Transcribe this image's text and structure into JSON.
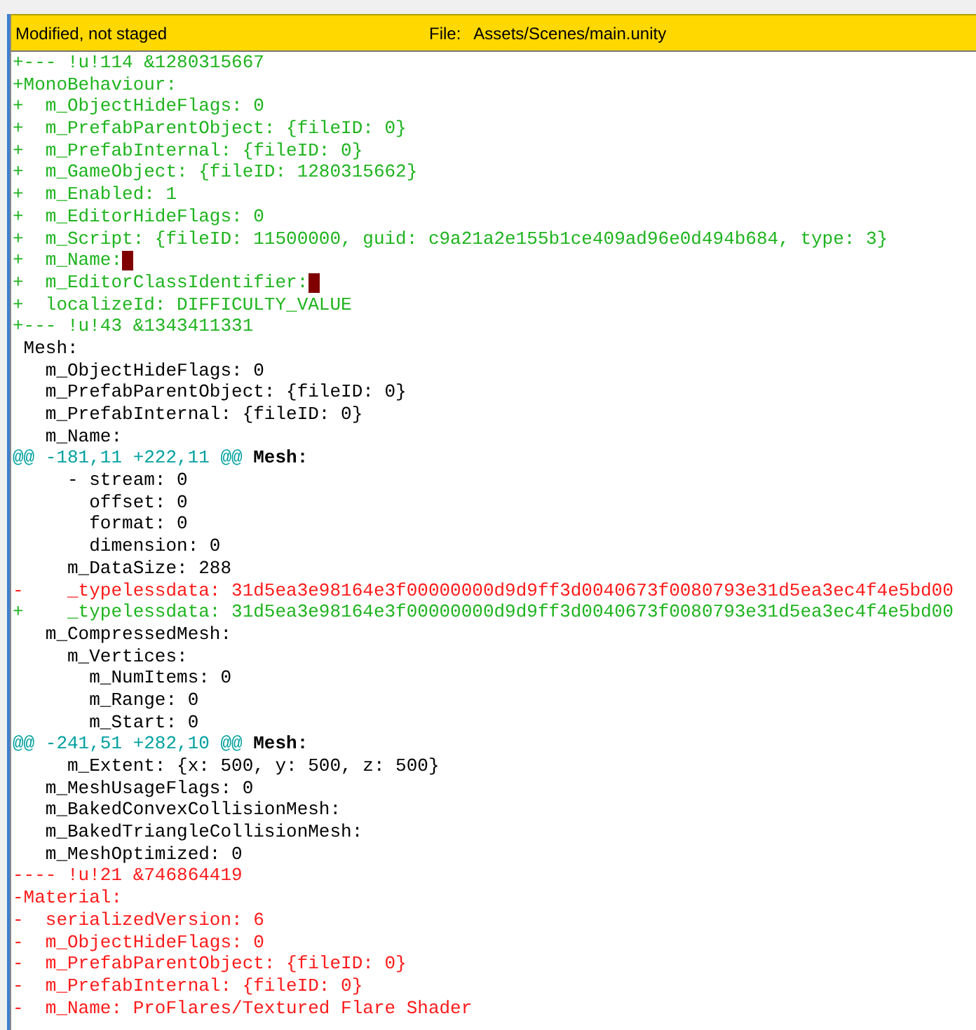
{
  "header": {
    "status": "Modified, not staged",
    "file_label": "File:",
    "file_path": "Assets/Scenes/main.unity"
  },
  "lines": [
    {
      "kind": "add",
      "text": "+--- !u!114 &1280315667"
    },
    {
      "kind": "add",
      "text": "+MonoBehaviour:"
    },
    {
      "kind": "add",
      "text": "+  m_ObjectHideFlags: 0"
    },
    {
      "kind": "add",
      "text": "+  m_PrefabParentObject: {fileID: 0}"
    },
    {
      "kind": "add",
      "text": "+  m_PrefabInternal: {fileID: 0}"
    },
    {
      "kind": "add",
      "text": "+  m_GameObject: {fileID: 1280315662}"
    },
    {
      "kind": "add",
      "text": "+  m_Enabled: 1"
    },
    {
      "kind": "add",
      "text": "+  m_EditorHideFlags: 0"
    },
    {
      "kind": "add",
      "text": "+  m_Script: {fileID: 11500000, guid: c9a21a2e155b1ce409ad96e0d494b684, type: 3}"
    },
    {
      "kind": "add",
      "text": "+  m_Name:",
      "trailing_whitespace": true
    },
    {
      "kind": "add",
      "text": "+  m_EditorClassIdentifier:",
      "trailing_whitespace": true
    },
    {
      "kind": "add",
      "text": "+  localizeId: DIFFICULTY_VALUE"
    },
    {
      "kind": "add",
      "text": "+--- !u!43 &1343411331"
    },
    {
      "kind": "context",
      "text": " Mesh:"
    },
    {
      "kind": "context",
      "text": "   m_ObjectHideFlags: 0"
    },
    {
      "kind": "context",
      "text": "   m_PrefabParentObject: {fileID: 0}"
    },
    {
      "kind": "context",
      "text": "   m_PrefabInternal: {fileID: 0}"
    },
    {
      "kind": "context",
      "text": "   m_Name:"
    },
    {
      "kind": "hunk",
      "text": "@@ -181,11 +222,11 @@",
      "section": "Mesh:"
    },
    {
      "kind": "context",
      "text": "     - stream: 0"
    },
    {
      "kind": "context",
      "text": "       offset: 0"
    },
    {
      "kind": "context",
      "text": "       format: 0"
    },
    {
      "kind": "context",
      "text": "       dimension: 0"
    },
    {
      "kind": "context",
      "text": "     m_DataSize: 288"
    },
    {
      "kind": "del",
      "text": "-    _typelessdata: 31d5ea3e98164e3f00000000d9d9ff3d0040673f0080793e31d5ea3ec4f4e5bd00"
    },
    {
      "kind": "add",
      "text": "+    _typelessdata: 31d5ea3e98164e3f00000000d9d9ff3d0040673f0080793e31d5ea3ec4f4e5bd00"
    },
    {
      "kind": "context",
      "text": "   m_CompressedMesh:"
    },
    {
      "kind": "context",
      "text": "     m_Vertices:"
    },
    {
      "kind": "context",
      "text": "       m_NumItems: 0"
    },
    {
      "kind": "context",
      "text": "       m_Range: 0"
    },
    {
      "kind": "context",
      "text": "       m_Start: 0"
    },
    {
      "kind": "hunk",
      "text": "@@ -241,51 +282,10 @@",
      "section": "Mesh:"
    },
    {
      "kind": "context",
      "text": "     m_Extent: {x: 500, y: 500, z: 500}"
    },
    {
      "kind": "context",
      "text": "   m_MeshUsageFlags: 0"
    },
    {
      "kind": "context",
      "text": "   m_BakedConvexCollisionMesh:"
    },
    {
      "kind": "context",
      "text": "   m_BakedTriangleCollisionMesh:"
    },
    {
      "kind": "context",
      "text": "   m_MeshOptimized: 0"
    },
    {
      "kind": "del",
      "text": "---- !u!21 &746864419"
    },
    {
      "kind": "del",
      "text": "-Material:"
    },
    {
      "kind": "del",
      "text": "-  serializedVersion: 6"
    },
    {
      "kind": "del",
      "text": "-  m_ObjectHideFlags: 0"
    },
    {
      "kind": "del",
      "text": "-  m_PrefabParentObject: {fileID: 0}"
    },
    {
      "kind": "del",
      "text": "-  m_PrefabInternal: {fileID: 0}"
    },
    {
      "kind": "del",
      "text": "-  m_Name: ProFlares/Textured Flare Shader"
    }
  ]
}
